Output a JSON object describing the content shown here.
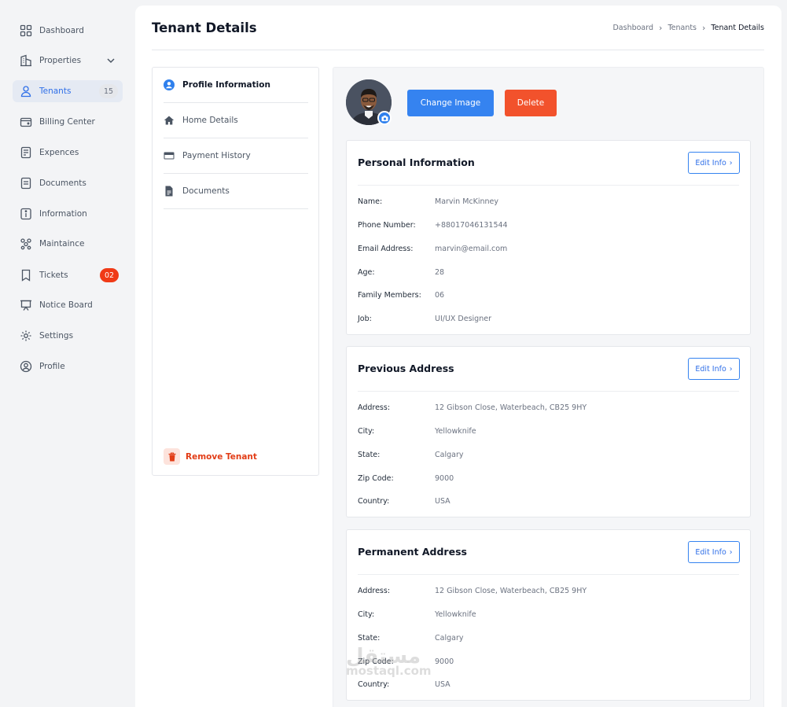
{
  "sidebar": {
    "items": [
      {
        "label": "Dashboard",
        "icon": "grid-icon"
      },
      {
        "label": "Properties",
        "icon": "building-icon"
      },
      {
        "label": "Tenants",
        "icon": "user-icon",
        "badge": "15"
      },
      {
        "label": "Billing Center",
        "icon": "wallet-icon"
      },
      {
        "label": "Expences",
        "icon": "receipt-icon"
      },
      {
        "label": "Documents",
        "icon": "document-icon"
      },
      {
        "label": "Information",
        "icon": "info-icon"
      },
      {
        "label": "Maintaince",
        "icon": "nodes-icon"
      },
      {
        "label": "Tickets",
        "icon": "bookmark-icon",
        "badge": "02"
      },
      {
        "label": "Notice Board",
        "icon": "board-icon"
      },
      {
        "label": "Settings",
        "icon": "gear-icon"
      },
      {
        "label": "Profile",
        "icon": "profile-icon"
      }
    ]
  },
  "header": {
    "title": "Tenant Details",
    "breadcrumb": [
      "Dashboard",
      "Tenants",
      "Tenant Details"
    ]
  },
  "tabs": [
    {
      "label": "Profile Information",
      "icon": "user-circle-icon"
    },
    {
      "label": "Home Details",
      "icon": "home-icon"
    },
    {
      "label": "Payment History",
      "icon": "credit-card-icon"
    },
    {
      "label": "Documents",
      "icon": "file-icon"
    }
  ],
  "remove_tenant": "Remove Tenant",
  "actions": {
    "change_image": "Change Image",
    "delete": "Delete"
  },
  "edit_label": "Edit Info",
  "cards": {
    "personal": {
      "title": "Personal Information",
      "rows": [
        {
          "label": "Name:",
          "value": "Marvin McKinney"
        },
        {
          "label": "Phone Number:",
          "value": "+88017046131544"
        },
        {
          "label": "Email Address:",
          "value": "marvin@email.com"
        },
        {
          "label": "Age:",
          "value": "28"
        },
        {
          "label": "Family Members:",
          "value": "06"
        },
        {
          "label": "Job:",
          "value": "UI/UX Designer"
        }
      ]
    },
    "previous": {
      "title": "Previous Address",
      "rows": [
        {
          "label": "Address:",
          "value": "12 Gibson Close, Waterbeach, CB25 9HY"
        },
        {
          "label": "City:",
          "value": "Yellowknife"
        },
        {
          "label": "State:",
          "value": "Calgary"
        },
        {
          "label": "Zip Code:",
          "value": "9000"
        },
        {
          "label": "Country:",
          "value": "USA"
        }
      ]
    },
    "permanent": {
      "title": "Permanent Address",
      "rows": [
        {
          "label": "Address:",
          "value": "12 Gibson Close, Waterbeach, CB25 9HY"
        },
        {
          "label": "City:",
          "value": "Yellowknife"
        },
        {
          "label": "State:",
          "value": "Calgary"
        },
        {
          "label": "Zip Code:",
          "value": "9000"
        },
        {
          "label": "Country:",
          "value": "USA"
        }
      ]
    }
  },
  "watermark": {
    "arabic": "مستقل",
    "latin": "mostaql.com"
  },
  "colors": {
    "accent": "#3583f0",
    "danger": "#f2522c",
    "badge_red": "#f03a17"
  }
}
